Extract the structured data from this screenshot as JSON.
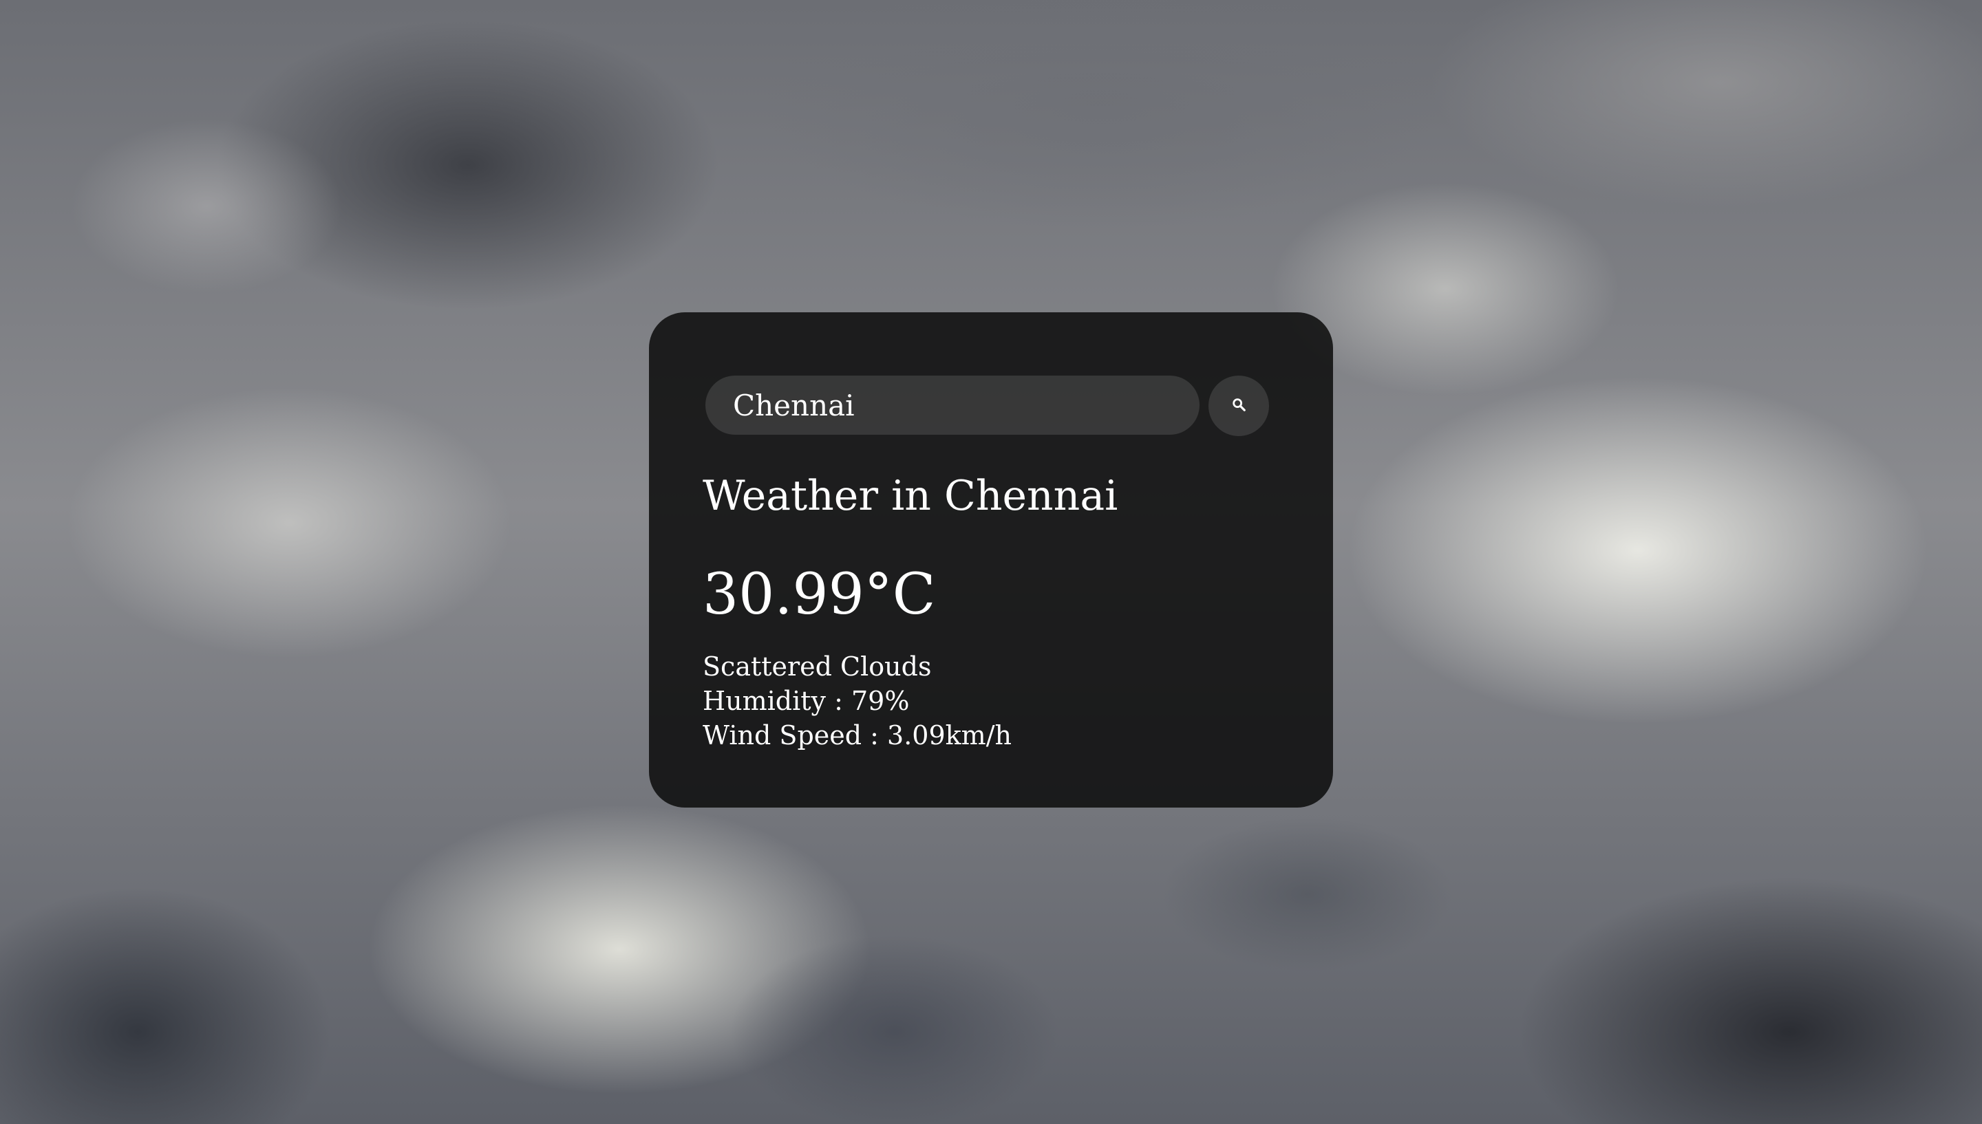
{
  "search": {
    "value": "Chennai",
    "button_icon": "search-icon"
  },
  "weather": {
    "title": "Weather in Chennai",
    "temperature": "30.99°C",
    "description": "Scattered Clouds",
    "humidity": "Humidity : 79%",
    "wind_speed": "Wind Speed : 3.09km/h"
  },
  "colors": {
    "card_background": "#0c0c0c",
    "text": "#ffffff"
  }
}
